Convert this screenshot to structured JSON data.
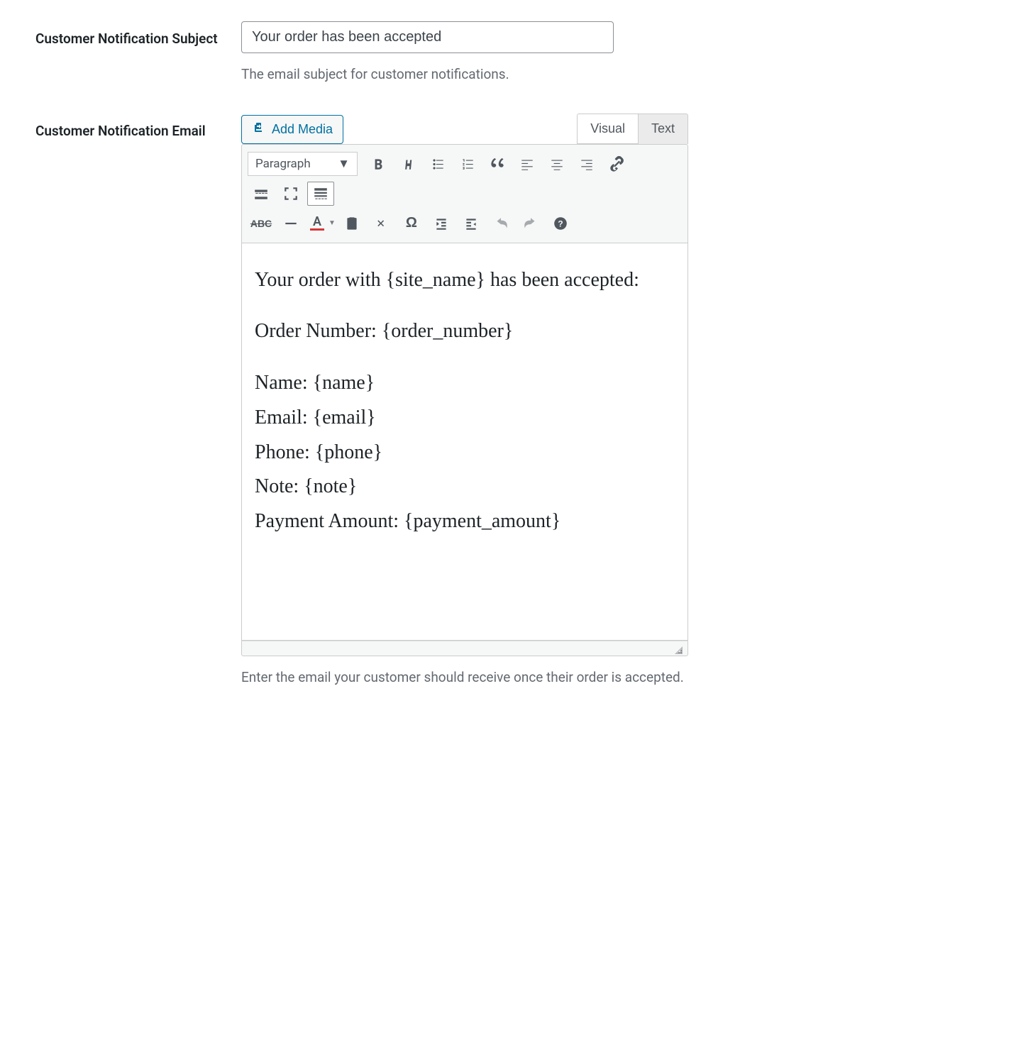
{
  "fields": {
    "subject": {
      "label": "Customer Notification Subject",
      "value": "Your order has been accepted",
      "description": "The email subject for customer notifications."
    },
    "email": {
      "label": "Customer Notification Email",
      "add_media": "Add Media",
      "tabs": {
        "visual": "Visual",
        "text": "Text"
      },
      "format_select": "Paragraph",
      "content": {
        "p1": "Your order with {site_name} has been accepted:",
        "p2": "Order Number: {order_number}",
        "p3": "Name: {name}",
        "p4": "Email: {email}",
        "p5": "Phone: {phone}",
        "p6": "Note: {note}",
        "p7": "Payment Amount: {payment_amount}"
      },
      "description": "Enter the email your customer should receive once their order is accepted."
    }
  }
}
